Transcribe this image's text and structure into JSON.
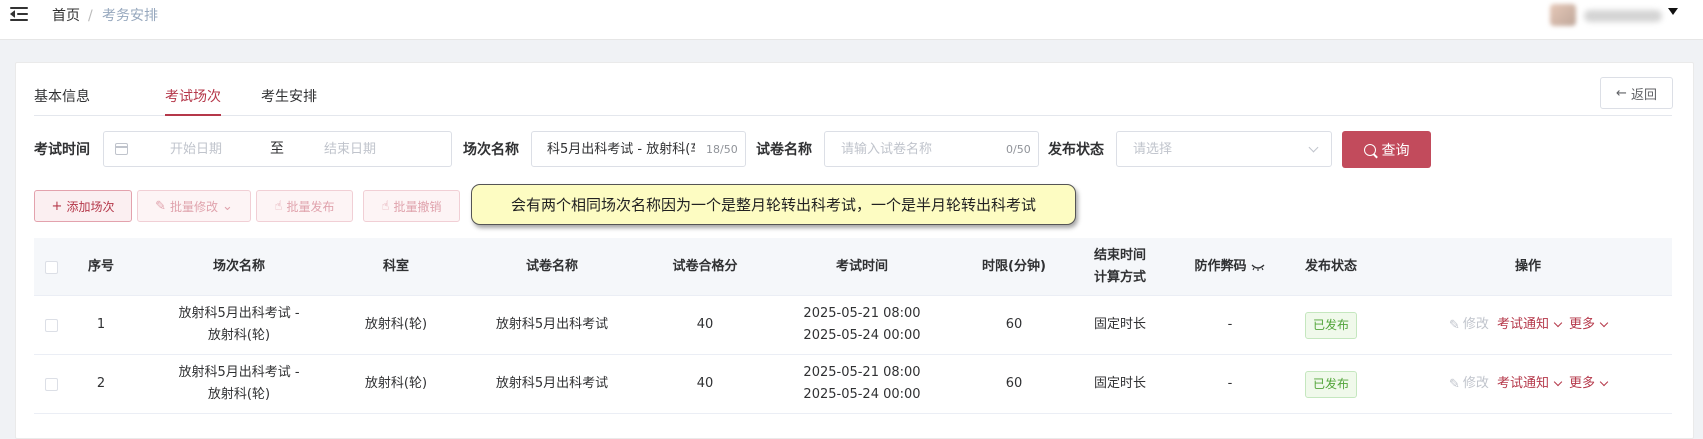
{
  "header": {
    "breadcrumb": {
      "home": "首页",
      "sep": "/",
      "current": "考务安排"
    }
  },
  "tabs": [
    "基本信息",
    "考试场次",
    "考生安排"
  ],
  "back_label": "返回",
  "filters": {
    "exam_time_label": "考试时间",
    "start_placeholder": "开始日期",
    "range_sep": "至",
    "end_placeholder": "结束日期",
    "session_name_label": "场次名称",
    "session_name_value": "科5月出科考试 - 放射科(车",
    "session_name_count": "18/50",
    "paper_name_label": "试卷名称",
    "paper_name_placeholder": "请输入试卷名称",
    "paper_name_count": "0/50",
    "publish_status_label": "发布状态",
    "publish_status_placeholder": "请选择",
    "query_label": "查询"
  },
  "actions": {
    "add": "添加场次",
    "batch_edit": "批量修改",
    "batch_publish": "批量发布",
    "batch_revoke": "批量撤销"
  },
  "tooltip": "会有两个相同场次名称因为一个是整月轮转出科考试，一个是半月轮转出科考试",
  "table": {
    "headers": {
      "index": "序号",
      "session_name": "场次名称",
      "dept": "科室",
      "paper_name": "试卷名称",
      "pass_score": "试卷合格分",
      "exam_time": "考试时间",
      "duration": "时限(分钟)",
      "end_calc_line1": "结束时间",
      "end_calc_line2": "计算方式",
      "anti_cheat": "防作弊码",
      "publish_status": "发布状态",
      "operation": "操作"
    },
    "rows": [
      {
        "index": "1",
        "session_line1": "放射科5月出科考试 -",
        "session_line2": "放射科(轮)",
        "dept": "放射科(轮)",
        "paper_name": "放射科5月出科考试",
        "pass_score": "40",
        "time_start": "2025-05-21 08:00",
        "time_end": "2025-05-24 00:00",
        "duration": "60",
        "end_calc": "固定时长",
        "anti_cheat": "-",
        "status": "已发布",
        "op_edit": "修改",
        "op_notice": "考试通知",
        "op_more": "更多"
      },
      {
        "index": "2",
        "session_line1": "放射科5月出科考试 -",
        "session_line2": "放射科(轮)",
        "dept": "放射科(轮)",
        "paper_name": "放射科5月出科考试",
        "pass_score": "40",
        "time_start": "2025-05-21 08:00",
        "time_end": "2025-05-24 00:00",
        "duration": "60",
        "end_calc": "固定时长",
        "anti_cheat": "-",
        "status": "已发布",
        "op_edit": "修改",
        "op_notice": "考试通知",
        "op_more": "更多"
      }
    ]
  },
  "colors": {
    "accent": "#b5384a",
    "query_button": "#c24b5c",
    "tooltip_bg": "#fdfcc2",
    "status_green": "#52a53a"
  },
  "icons": [
    "menu-fold-icon",
    "calendar-icon",
    "search-icon",
    "plus-icon",
    "edit-icon",
    "publish-icon",
    "revoke-icon",
    "eye-closed-icon",
    "chevron-down-icon",
    "arrow-left-icon"
  ]
}
